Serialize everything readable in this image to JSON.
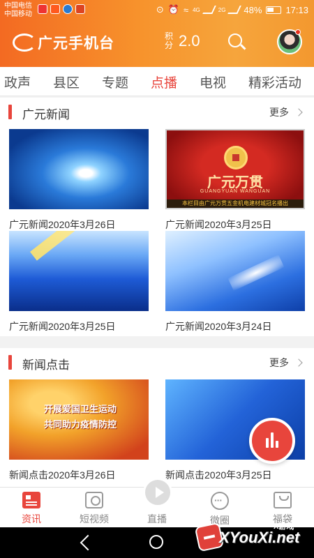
{
  "status_bar": {
    "carrier_1": "中国电信",
    "carrier_2": "中国移动",
    "network_1": "4G",
    "network_2": "2G",
    "battery": "48%",
    "time": "17:13"
  },
  "header": {
    "app_name": "广元手机台",
    "points_label": "积分",
    "points_value": "2.0"
  },
  "tabs": [
    {
      "label": "政声"
    },
    {
      "label": "县区"
    },
    {
      "label": "专题"
    },
    {
      "label": "点播",
      "active": true
    },
    {
      "label": "电视"
    },
    {
      "label": "精彩活动"
    }
  ],
  "sections": [
    {
      "title": "广元新闻",
      "more": "更多",
      "items": [
        {
          "caption": "广元新闻2020年3月26日"
        },
        {
          "caption": "广元新闻2020年3月25日",
          "thumb_title": "广元万贯",
          "thumb_subtitle": "GUANGYUAN WANGUAN",
          "thumb_banner": "本栏目由广元万贯五金机电建材城冠名播出"
        },
        {
          "caption": "广元新闻2020年3月25日"
        },
        {
          "caption": "广元新闻2020年3月24日"
        }
      ]
    },
    {
      "title": "新闻点击",
      "more": "更多",
      "items": [
        {
          "caption": "新闻点击2020年3月26日",
          "thumb_line_1": "开展爱国卫生运动",
          "thumb_line_2": "共同助力疫情防控"
        },
        {
          "caption": "新闻点击2020年3月25日"
        }
      ]
    }
  ],
  "bottom_nav": [
    {
      "label": "资讯",
      "icon": "news-icon",
      "active": true
    },
    {
      "label": "短视频",
      "icon": "camera-icon"
    },
    {
      "label": "直播",
      "icon": "live-play-icon"
    },
    {
      "label": "微圈",
      "icon": "chat-icon"
    },
    {
      "label": "福袋",
      "icon": "bag-icon"
    }
  ],
  "watermark": {
    "site": "XYouXi.net",
    "tag": "X游戏"
  },
  "colors": {
    "accent": "#e8453c",
    "header_gradient_start": "#f36a22",
    "header_gradient_end": "#f6a53c"
  }
}
